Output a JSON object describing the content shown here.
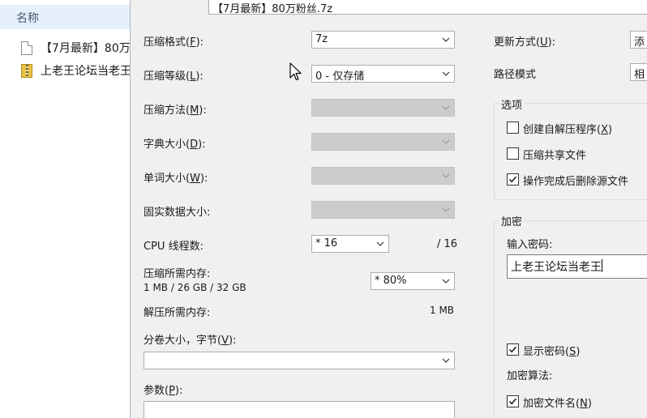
{
  "explorer": {
    "column_header": "名称",
    "files": [
      {
        "name": "【7月最新】80万",
        "icon": "document-icon"
      },
      {
        "name": "上老王论坛当老王",
        "icon": "zip-archive-icon"
      }
    ]
  },
  "archive_path": "【7月最新】80万粉丝.7z",
  "left": {
    "format_label": "压缩格式(",
    "format_key": "F",
    "format_suffix": "):",
    "format_value": "7z",
    "level_label": "压缩等级(",
    "level_key": "L",
    "level_suffix": "):",
    "level_value": "0 - 仅存储",
    "method_label": "压缩方法(",
    "method_key": "M",
    "method_suffix": "):",
    "dict_label": "字典大小(",
    "dict_key": "D",
    "dict_suffix": "):",
    "word_label": "单词大小(",
    "word_key": "W",
    "word_suffix": "):",
    "solid_label": "固实数据大小:",
    "cpu_label": "CPU 线程数:",
    "cpu_value": "* 16",
    "cpu_max": "/ 16",
    "mem_label": "压缩所需内存:",
    "mem_info": "1 MB / 26 GB / 32 GB",
    "mem_value": "* 80%",
    "decomp_label": "解压所需内存:",
    "decomp_value": "1 MB",
    "volume_label": "分卷大小，字节(",
    "volume_key": "V",
    "volume_suffix": "):",
    "volume_value": "",
    "params_label": "参数(",
    "params_key": "P",
    "params_suffix": "):"
  },
  "right": {
    "update_label": "更新方式(",
    "update_key": "U",
    "update_suffix": "):",
    "update_value": "添",
    "path_label": "路径模式",
    "path_value": "相",
    "options_title": "选项",
    "opt_sfx": "创建自解压程序(",
    "opt_sfx_key": "X",
    "opt_sfx_suffix": ")",
    "opt_sfx_checked": false,
    "opt_shared": "压缩共享文件",
    "opt_shared_checked": false,
    "opt_delete": "操作完成后删除源文件",
    "opt_delete_checked": true,
    "encrypt_title": "加密",
    "password_label": "输入密码:",
    "password_value": "上老王论坛当老王",
    "show_pw": "显示密码(",
    "show_pw_key": "S",
    "show_pw_suffix": ")",
    "show_pw_checked": true,
    "algo_label": "加密算法:",
    "enc_names": "加密文件名(",
    "enc_names_key": "N",
    "enc_names_suffix": ")",
    "enc_names_checked": true
  },
  "colors": {
    "dialog_bg": "#f0f0f0",
    "header_bg": "#e5f0fb",
    "disabled_combo": "#cccccc"
  }
}
